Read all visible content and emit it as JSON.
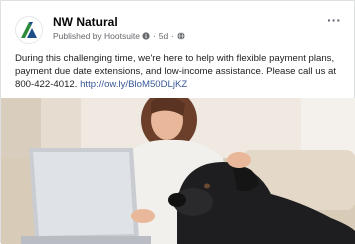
{
  "post": {
    "page_name": "NW Natural",
    "published_by": "Published by Hootsuite",
    "time_ago": "5d",
    "more_icon": "more-horizontal-icon",
    "body_text": "During this challenging time, we're here to help with flexible payment plans, payment due date extensions, and low-income assistance. Please call us at 800-422-4012.",
    "link_text": "http://ow.ly/BloM50DLjKZ",
    "colors": {
      "brand_green": "#2e8b3a",
      "brand_blue": "#1b4f8a",
      "link": "#385898"
    }
  }
}
